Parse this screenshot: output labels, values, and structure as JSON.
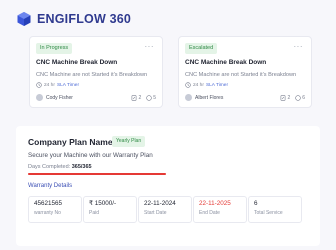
{
  "header": {
    "brand": "ENGIFLOW 360",
    "logo_icon": "cube-logo-icon",
    "brand_color": "#2f3a8f"
  },
  "tickets": [
    {
      "status": "In Progress",
      "title": "CNC Machine Break Down",
      "description": "CNC Machine are not Started it's Breakdown",
      "sla_prefix": "24 hr",
      "sla_link": "SLA Timer",
      "assignee": "Cody Fisher",
      "attachments": "2",
      "comments": "5"
    },
    {
      "status": "Escalated",
      "title": "CNC Machine Break Down",
      "description": "CNC Machine are not Started it's Breakdown",
      "sla_prefix": "24 hr",
      "sla_link": "SLA Timer",
      "assignee": "Albert Flores",
      "attachments": "2",
      "comments": "6"
    }
  ],
  "plan": {
    "name": "Company Plan Name",
    "badge": "Yearly Plan",
    "subtitle": "Secure your Machine with our Warranty Plan",
    "days_label": "Days Completed:",
    "days_value": "365/365",
    "progress_fraction": 1.0,
    "accent_color": "#e53935",
    "details_heading": "Warranty Details",
    "details": [
      {
        "value": "45621565",
        "label": "warranty No",
        "highlight": false
      },
      {
        "value": "₹ 15000/-",
        "label": "Paid",
        "highlight": false
      },
      {
        "value": "22-11-2024",
        "label": "Start Date",
        "highlight": false
      },
      {
        "value": "22-11-2025",
        "label": "End Date",
        "highlight": true
      },
      {
        "value": "6",
        "label": "Total Service",
        "highlight": false
      }
    ]
  }
}
